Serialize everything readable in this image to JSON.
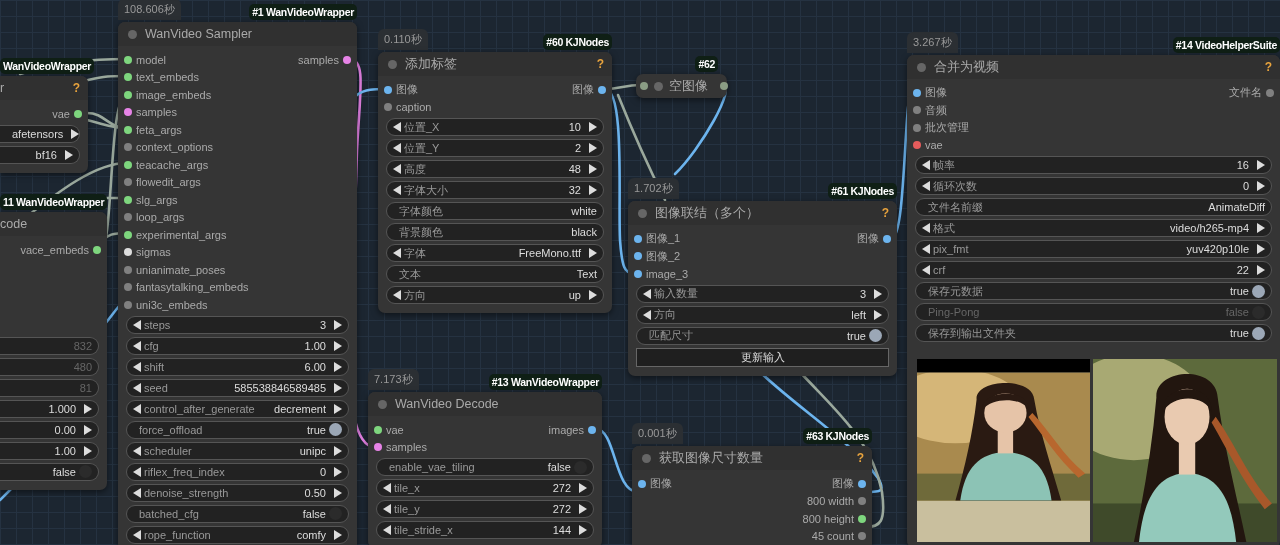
{
  "nodes": [
    {
      "badge": "WanVideoWrapper",
      "title": "r",
      "help": "?",
      "collapsed": false,
      "outputs": [
        {
          "name": "vae",
          "color": "#7ed67e"
        }
      ],
      "widgets": [
        {
          "kind": "combo",
          "value": "afetensors"
        },
        {
          "kind": "combo",
          "value": "bf16"
        }
      ]
    },
    {
      "badge": "11 WanVideoWrapper",
      "title": "code",
      "collapsed": false,
      "outputs": [
        {
          "name": "vace_embeds",
          "color": "#7ed67e"
        }
      ],
      "widgets": [
        {
          "kind": "number",
          "value": "832",
          "disabled": true
        },
        {
          "kind": "number",
          "value": "480",
          "disabled": true
        },
        {
          "kind": "number",
          "value": "81",
          "disabled": true
        },
        {
          "kind": "number",
          "value": "1.000",
          "disabled": false
        },
        {
          "kind": "number",
          "value": "0.00",
          "disabled": false
        },
        {
          "kind": "number",
          "value": "1.00",
          "disabled": false
        },
        {
          "kind": "toggle",
          "value": "false",
          "on": false,
          "disabled": false
        }
      ]
    },
    {
      "time": "108.606秒",
      "badge": "#1 WanVideoWrapper",
      "title": "WanVideo Sampler",
      "collapsed": false,
      "inputs": [
        {
          "name": "model",
          "color": "#7ed67e"
        },
        {
          "name": "text_embeds",
          "color": "#7ed67e"
        },
        {
          "name": "image_embeds",
          "color": "#7ed67e"
        },
        {
          "name": "samples",
          "color": "#e683e6"
        },
        {
          "name": "feta_args",
          "color": "#7ed67e"
        },
        {
          "name": "context_options",
          "color": "#808080"
        },
        {
          "name": "teacache_args",
          "color": "#7ed67e"
        },
        {
          "name": "flowedit_args",
          "color": "#808080"
        },
        {
          "name": "slg_args",
          "color": "#7ed67e"
        },
        {
          "name": "loop_args",
          "color": "#808080"
        },
        {
          "name": "experimental_args",
          "color": "#7ed67e"
        },
        {
          "name": "sigmas",
          "color": "#dddddd"
        },
        {
          "name": "unianimate_poses",
          "color": "#808080"
        },
        {
          "name": "fantasytalking_embeds",
          "color": "#808080"
        },
        {
          "name": "uni3c_embeds",
          "color": "#808080"
        }
      ],
      "outputs": [
        {
          "name": "samples",
          "color": "#e683e6"
        }
      ],
      "widgets": [
        {
          "kind": "number",
          "label": "steps",
          "value": "3"
        },
        {
          "kind": "number",
          "label": "cfg",
          "value": "1.00"
        },
        {
          "kind": "number",
          "label": "shift",
          "value": "6.00"
        },
        {
          "kind": "number",
          "label": "seed",
          "value": "585538846589485"
        },
        {
          "kind": "combo",
          "label": "control_after_generate",
          "value": "decrement"
        },
        {
          "kind": "toggle",
          "label": "force_offload",
          "value": "true",
          "on": true
        },
        {
          "kind": "combo",
          "label": "scheduler",
          "value": "unipc"
        },
        {
          "kind": "number",
          "label": "riflex_freq_index",
          "value": "0"
        },
        {
          "kind": "number",
          "label": "denoise_strength",
          "value": "0.50"
        },
        {
          "kind": "toggle",
          "label": "batched_cfg",
          "value": "false",
          "on": false
        },
        {
          "kind": "combo",
          "label": "rope_function",
          "value": "comfy"
        }
      ]
    },
    {
      "time": "0.110秒",
      "badge": "#60 KJNodes",
      "title": "添加标签",
      "help": "?",
      "collapsed": false,
      "inputs": [
        {
          "name": "图像",
          "color": "#6cb4ee"
        },
        {
          "name": "caption",
          "color": "#808080"
        }
      ],
      "outputs": [
        {
          "name": "图像",
          "color": "#6cb4ee"
        }
      ],
      "widgets": [
        {
          "kind": "number",
          "label": "位置_X",
          "value": "10"
        },
        {
          "kind": "number",
          "label": "位置_Y",
          "value": "2"
        },
        {
          "kind": "number",
          "label": "高度",
          "value": "48"
        },
        {
          "kind": "number",
          "label": "字体大小",
          "value": "32"
        },
        {
          "kind": "text",
          "label": "字体颜色",
          "value": "white"
        },
        {
          "kind": "text",
          "label": "背景颜色",
          "value": "black"
        },
        {
          "kind": "combo",
          "label": "字体",
          "value": "FreeMono.ttf"
        },
        {
          "kind": "text",
          "label": "文本",
          "value": "Text"
        },
        {
          "kind": "combo",
          "label": "方向",
          "value": "up"
        }
      ]
    },
    {
      "badge": "#62",
      "title": "空图像",
      "collapsed": true,
      "inputs": [
        {
          "color": "#8a9c84"
        }
      ],
      "outputs": [
        {
          "color": "#8a9c84"
        }
      ]
    },
    {
      "time": "1.702秒",
      "badge": "#61 KJNodes",
      "title": "图像联结（多个）",
      "help": "?",
      "collapsed": false,
      "inputs": [
        {
          "name": "图像_1",
          "color": "#6cb4ee"
        },
        {
          "name": "图像_2",
          "color": "#6cb4ee"
        },
        {
          "name": "image_3",
          "color": "#6cb4ee"
        }
      ],
      "outputs": [
        {
          "name": "图像",
          "color": "#6cb4ee"
        }
      ],
      "widgets": [
        {
          "kind": "number",
          "label": "输入数量",
          "value": "3"
        },
        {
          "kind": "combo",
          "label": "方向",
          "value": "left"
        },
        {
          "kind": "toggle",
          "label": "匹配尺寸",
          "value": "true",
          "on": true
        },
        {
          "kind": "button",
          "label": "更新输入"
        }
      ]
    },
    {
      "time": "7.173秒",
      "badge": "#13 WanVideoWrapper",
      "title": "WanVideo Decode",
      "collapsed": false,
      "inputs": [
        {
          "name": "vae",
          "color": "#7ed67e"
        },
        {
          "name": "samples",
          "color": "#e683e6"
        }
      ],
      "outputs": [
        {
          "name": "images",
          "color": "#6cb4ee"
        }
      ],
      "widgets": [
        {
          "kind": "toggle",
          "label": "enable_vae_tiling",
          "value": "false",
          "on": false
        },
        {
          "kind": "number",
          "label": "tile_x",
          "value": "272"
        },
        {
          "kind": "number",
          "label": "tile_y",
          "value": "272"
        },
        {
          "kind": "number",
          "label": "tile_stride_x",
          "value": "144"
        }
      ]
    },
    {
      "time": "0.001秒",
      "badge": "#63 KJNodes",
      "title": "获取图像尺寸数量",
      "help": "?",
      "collapsed": false,
      "inputs": [
        {
          "name": "图像",
          "color": "#6cb4ee"
        }
      ],
      "outputs": [
        {
          "name": "图像",
          "color": "#6cb4ee"
        },
        {
          "name": "800 width",
          "color": "#808080"
        },
        {
          "name": "800 height",
          "color": "#7ed67e"
        },
        {
          "name": "45 count",
          "color": "#808080"
        }
      ]
    },
    {
      "time": "3.267秒",
      "badge": "#14 VideoHelperSuite",
      "title": "合并为视频",
      "help": "?",
      "collapsed": false,
      "inputs": [
        {
          "name": "图像",
          "color": "#6cb4ee"
        },
        {
          "name": "音频",
          "color": "#808080"
        },
        {
          "name": "批次管理",
          "color": "#808080"
        },
        {
          "name": "vae",
          "color": "#e65c5c"
        }
      ],
      "outputs": [
        {
          "name": "文件名",
          "color": "#808080"
        }
      ],
      "widgets": [
        {
          "kind": "number",
          "label": "帧率",
          "value": "16",
          "disabled": false
        },
        {
          "kind": "number",
          "label": "循环次数",
          "value": "0",
          "disabled": false
        },
        {
          "kind": "text",
          "label": "文件名前缀",
          "value": "AnimateDiff",
          "disabled": false
        },
        {
          "kind": "combo",
          "label": "格式",
          "value": "video/h265-mp4",
          "disabled": false
        },
        {
          "kind": "combo",
          "label": "pix_fmt",
          "value": "yuv420p10le",
          "disabled": false
        },
        {
          "kind": "number",
          "label": "crf",
          "value": "22",
          "disabled": false
        },
        {
          "kind": "toggle",
          "label": "保存元数据",
          "value": "true",
          "on": true,
          "disabled": false
        },
        {
          "kind": "toggle",
          "label": "Ping-Pong",
          "value": "false",
          "on": false,
          "disabled": true
        },
        {
          "kind": "toggle",
          "label": "保存到输出文件夹",
          "value": "true",
          "on": true,
          "disabled": false
        }
      ],
      "previews": [
        {
          "kind": "picture",
          "banner": true
        },
        {
          "kind": "picture",
          "banner": false
        }
      ]
    }
  ]
}
